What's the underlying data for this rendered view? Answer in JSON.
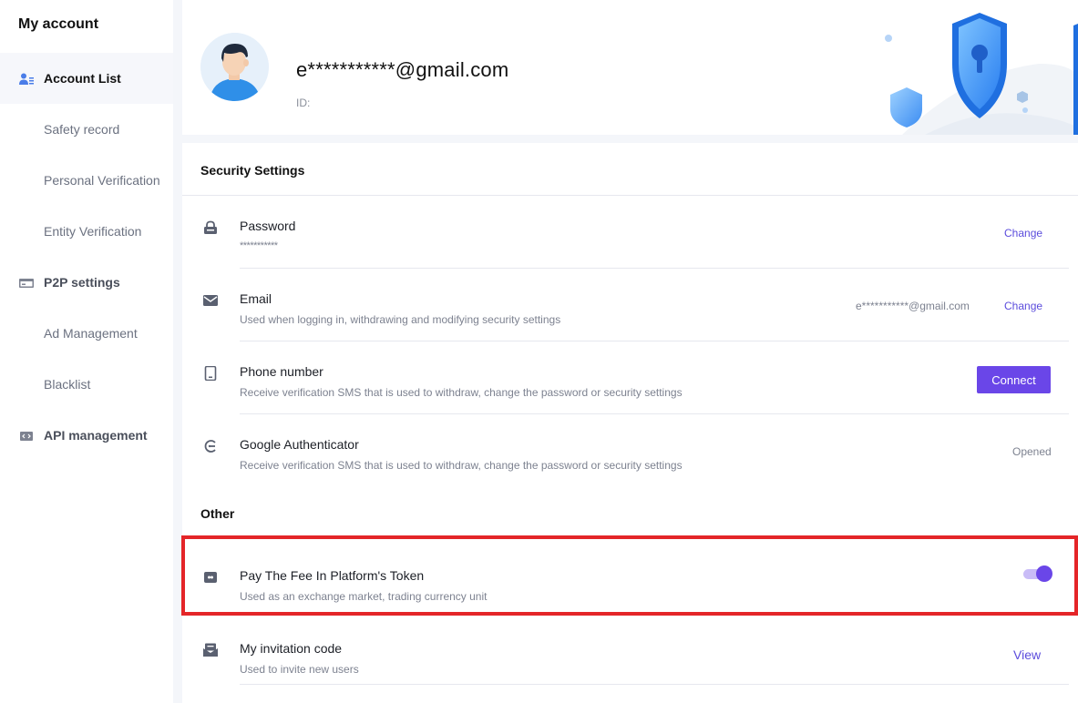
{
  "sidebar": {
    "title": "My account",
    "items": [
      {
        "label": "Account List",
        "icon": "user-list-icon",
        "active": true,
        "section": true
      },
      {
        "label": "Safety record"
      },
      {
        "label": "Personal Verification"
      },
      {
        "label": "Entity Verification"
      },
      {
        "label": "P2P settings",
        "icon": "card-icon",
        "section": true
      },
      {
        "label": "Ad Management"
      },
      {
        "label": "Blacklist"
      },
      {
        "label": "API management",
        "icon": "code-icon",
        "section": true
      }
    ]
  },
  "profile": {
    "email": "e***********@gmail.com",
    "id_label": "ID:"
  },
  "security": {
    "heading": "Security Settings",
    "password": {
      "title": "Password",
      "mask": "***********",
      "action": "Change",
      "icon": "lock-icon"
    },
    "email": {
      "title": "Email",
      "desc": "Used when logging in, withdrawing and modifying security settings",
      "value": "e***********@gmail.com",
      "action": "Change",
      "icon": "envelope-icon"
    },
    "phone": {
      "title": "Phone number",
      "desc": "Receive verification SMS that is used to withdraw, change the password or security settings",
      "action": "Connect",
      "icon": "phone-icon"
    },
    "google": {
      "title": "Google Authenticator",
      "desc": "Receive verification SMS that is used to withdraw, change the password or security settings",
      "status": "Opened",
      "icon": "google-icon"
    }
  },
  "other": {
    "heading": "Other",
    "fee_token": {
      "title": "Pay The Fee In Platform's Token",
      "desc": "Used as an exchange market, trading currency unit",
      "enabled": true,
      "icon": "token-icon"
    },
    "invitation": {
      "title": "My invitation code",
      "desc": "Used to invite new users",
      "action": "View",
      "icon": "mail-open-icon"
    }
  },
  "colors": {
    "accent": "#6a46e8",
    "link": "#5b4cdc",
    "highlight": "#e42528"
  }
}
